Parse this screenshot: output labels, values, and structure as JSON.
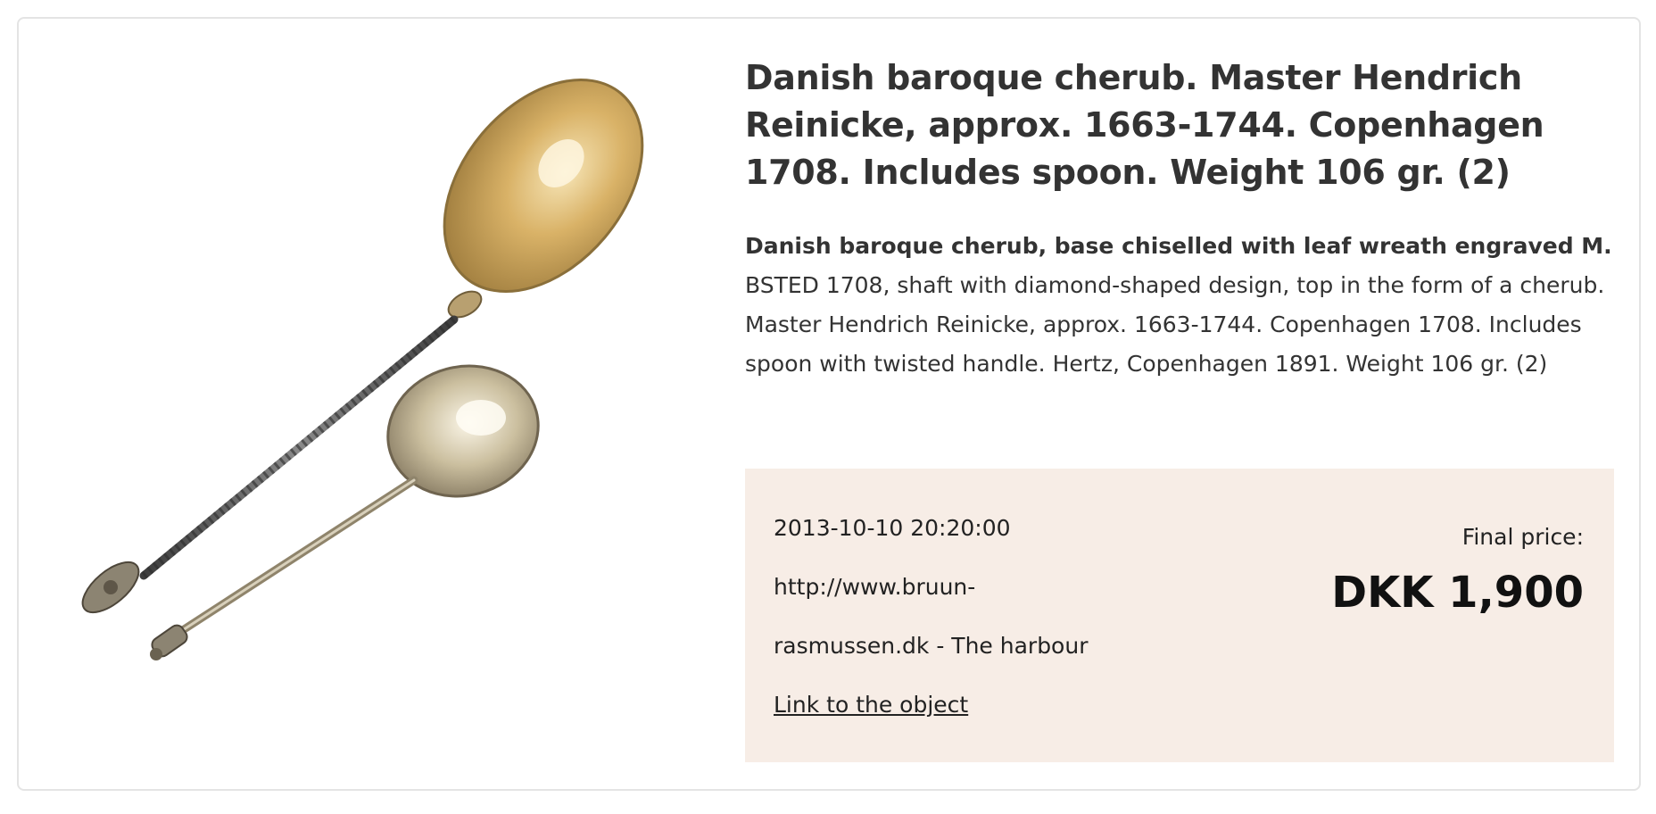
{
  "lot": {
    "title": "Danish baroque cherub. Master Hendrich Reinicke, approx. 1663-1744. Copenhagen 1708. Includes spoon. Weight 106 gr. (2)",
    "description_bold": "Danish baroque cherub, base chiselled with leaf wreath engraved M.",
    "description_rest": " BSTED 1708, shaft with diamond-shaped design, top in the form of a cherub. Master Hendrich Reinicke, approx. 1663-1744. Copenhagen 1708. Includes spoon with twisted handle. Hertz, Copenhagen 1891. Weight 106 gr. (2)"
  },
  "sale": {
    "date": "2013-10-10 20:20:00",
    "source": "http://www.bruun-rasmussen.dk - The harbour",
    "link_label": "Link to the object",
    "final_price_label": "Final price:",
    "final_price": "DKK 1,900"
  },
  "colors": {
    "price_box_bg": "#f7ede6",
    "text": "#333333"
  }
}
